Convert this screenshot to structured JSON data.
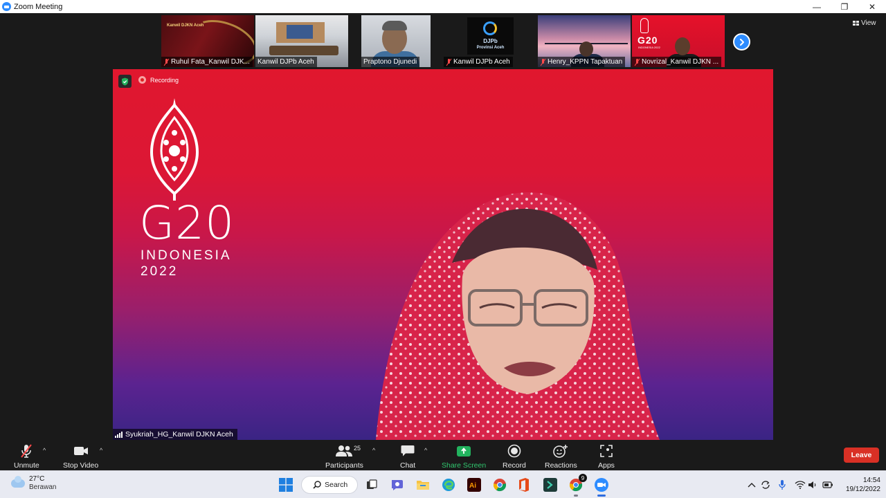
{
  "window": {
    "title": "Zoom Meeting",
    "controls": {
      "minimize": "—",
      "restore": "❐",
      "close": "✕"
    }
  },
  "view_button": {
    "label": "View"
  },
  "thumbnails": [
    {
      "name": "Ruhul Fata_Kanwil DJK...",
      "muted": true,
      "slide_text": "Kanwil DJKN Aceh"
    },
    {
      "name": "Kanwil DJPb Aceh",
      "muted": false
    },
    {
      "name": "Praptono Djunedi",
      "muted": false
    },
    {
      "name": "Kanwil DJPb Aceh",
      "muted": true,
      "logo_line1": "DJPb",
      "logo_line2": "Provinsi Aceh"
    },
    {
      "name": "Henry_KPPN Tapaktuan",
      "muted": true
    },
    {
      "name": "Novrizal_Kanwil DJKN ...",
      "muted": true,
      "logo_text": "G20",
      "logo_sub": "INDONESIA 2022"
    }
  ],
  "speaker": {
    "name": "Syukriah_HG_Kanwil DJKN Aceh",
    "recording_label": "Recording",
    "background": {
      "logo": "G20",
      "line1": "INDONESIA",
      "line2": "2022"
    }
  },
  "toolbar": {
    "unmute": "Unmute",
    "stop_video": "Stop Video",
    "participants": "Participants",
    "participants_count": "25",
    "chat": "Chat",
    "share_screen": "Share Screen",
    "record": "Record",
    "reactions": "Reactions",
    "apps": "Apps",
    "leave": "Leave"
  },
  "colors": {
    "zoom_blue": "#2D8CFF",
    "share_green": "#22b35e",
    "leave_red": "#d93025",
    "g20_red": "#e0172e",
    "g20_purple": "#3a2484"
  },
  "taskbar": {
    "weather_temp": "27°C",
    "weather_condition": "Berawan",
    "search_label": "Search",
    "chrome_badge": "9",
    "time": "14:54",
    "date": "19/12/2022"
  }
}
